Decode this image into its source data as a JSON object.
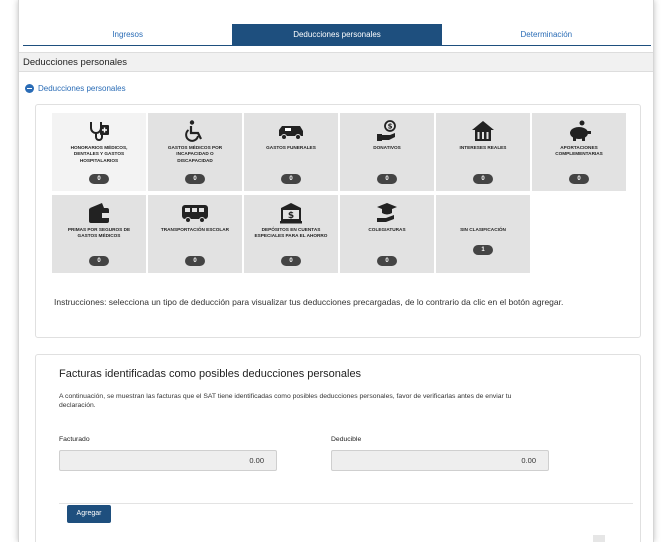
{
  "tabs": [
    {
      "label": "Ingresos",
      "active": false
    },
    {
      "label": "Deducciones personales",
      "active": true
    },
    {
      "label": "Determinación",
      "active": false
    }
  ],
  "section_title": "Deducciones personales",
  "collapse_label": "Deducciones personales",
  "tiles": [
    {
      "label": "Honorarios médicos, dentales y gastos hospitalarios",
      "count": "0",
      "icon": "medical-icon"
    },
    {
      "label": "Gastos médicos por incapacidad o discapacidad",
      "count": "0",
      "icon": "wheelchair-icon"
    },
    {
      "label": "Gastos funerales",
      "count": "0",
      "icon": "hearse-icon"
    },
    {
      "label": "Donativos",
      "count": "0",
      "icon": "donation-icon"
    },
    {
      "label": "Intereses reales",
      "count": "0",
      "icon": "house-icon"
    },
    {
      "label": "Aportaciones complementarias",
      "count": "0",
      "icon": "piggy-bank-icon"
    },
    {
      "label": "Primas por seguros de gastos médicos",
      "count": "0",
      "icon": "wallet-icon"
    },
    {
      "label": "Transportación escolar",
      "count": "0",
      "icon": "bus-icon"
    },
    {
      "label": "Depósitos en cuentas especiales para el ahorro",
      "count": "0",
      "icon": "bank-icon"
    },
    {
      "label": "Colegiaturas",
      "count": "0",
      "icon": "graduation-icon"
    },
    {
      "label": "Sin clasificación",
      "count": "1",
      "icon": ""
    }
  ],
  "instructions": "Instrucciones: selecciona un tipo de deducción para visualizar tus deducciones precargadas, de lo contrario da clic en el botón agregar.",
  "invoices": {
    "title": "Facturas identificadas como posibles deducciones personales",
    "description": "A continuación, se muestran las facturas que el SAT tiene identificadas como posibles deducciones personales, favor de verificarlas antes de enviar tu declaración.",
    "facturado_label": "Facturado",
    "facturado_value": "0.00",
    "deducible_label": "Deducible",
    "deducible_value": "0.00",
    "add_button": "Agregar"
  },
  "colors": {
    "primary": "#1e4f7e",
    "link": "#2a6cb6",
    "tile": "#e2e2e2",
    "badge": "#444444"
  }
}
